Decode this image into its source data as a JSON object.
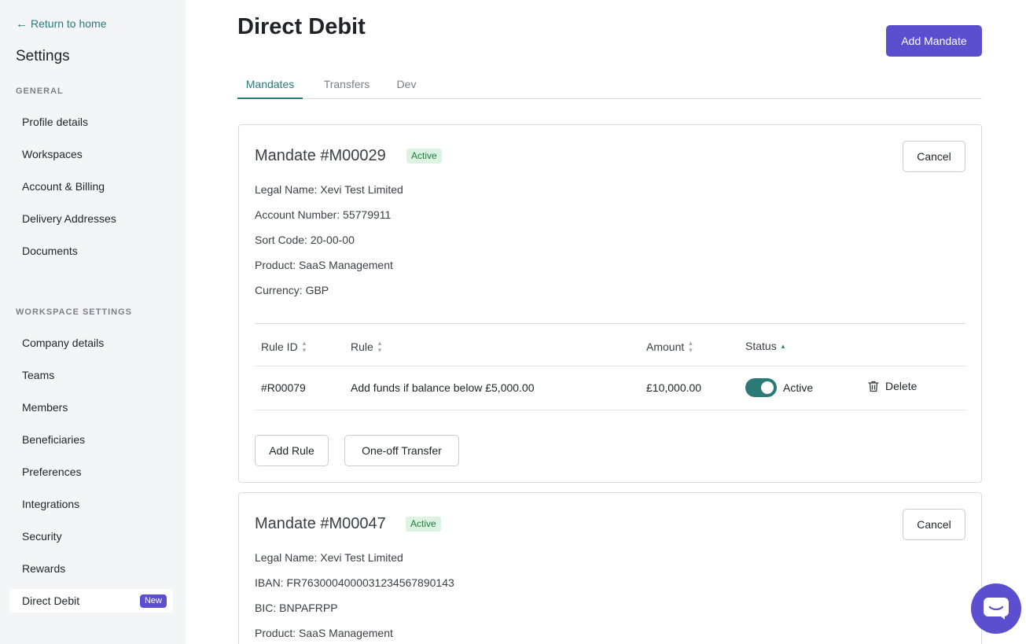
{
  "sidebar": {
    "back_label": "Return to home",
    "title": "Settings",
    "general_label": "GENERAL",
    "general_items": [
      "Profile details",
      "Workspaces",
      "Account & Billing",
      "Delivery Addresses",
      "Documents"
    ],
    "workspace_label": "WORKSPACE SETTINGS",
    "workspace_items": [
      "Company details",
      "Teams",
      "Members",
      "Beneficiaries",
      "Preferences",
      "Integrations",
      "Security",
      "Rewards"
    ],
    "active_item": "Direct Debit",
    "active_badge": "New"
  },
  "header": {
    "title": "Direct Debit",
    "add_button": "Add Mandate"
  },
  "tabs": [
    {
      "label": "Mandates",
      "active": true
    },
    {
      "label": "Transfers",
      "active": false
    },
    {
      "label": "Dev",
      "active": false
    }
  ],
  "mandates": [
    {
      "title": "Mandate #M00029",
      "status": "Active",
      "cancel_label": "Cancel",
      "details": [
        "Legal Name: Xevi Test Limited",
        "Account Number: 55779911",
        "Sort Code: 20-00-00",
        "Product: SaaS Management",
        "Currency: GBP"
      ],
      "table": {
        "headers": [
          "Rule ID",
          "Rule",
          "Amount",
          "Status"
        ],
        "rows": [
          {
            "id": "#R00079",
            "rule": "Add funds if balance below £5,000.00",
            "amount": "£10,000.00",
            "status": "Active",
            "enabled": true,
            "delete_label": "Delete"
          }
        ]
      },
      "add_rule_label": "Add Rule",
      "one_off_label": "One-off Transfer"
    },
    {
      "title": "Mandate #M00047",
      "status": "Active",
      "cancel_label": "Cancel",
      "details": [
        "Legal Name: Xevi Test Limited",
        "IBAN: FR7630004000031234567890143",
        "BIC: BNPAFRPP",
        "Product: SaaS Management"
      ]
    }
  ],
  "colors": {
    "accent": "#5b4fcf",
    "teal": "#2b7a78",
    "status_bg": "#dcf3e2",
    "status_text": "#1e7a3a"
  }
}
